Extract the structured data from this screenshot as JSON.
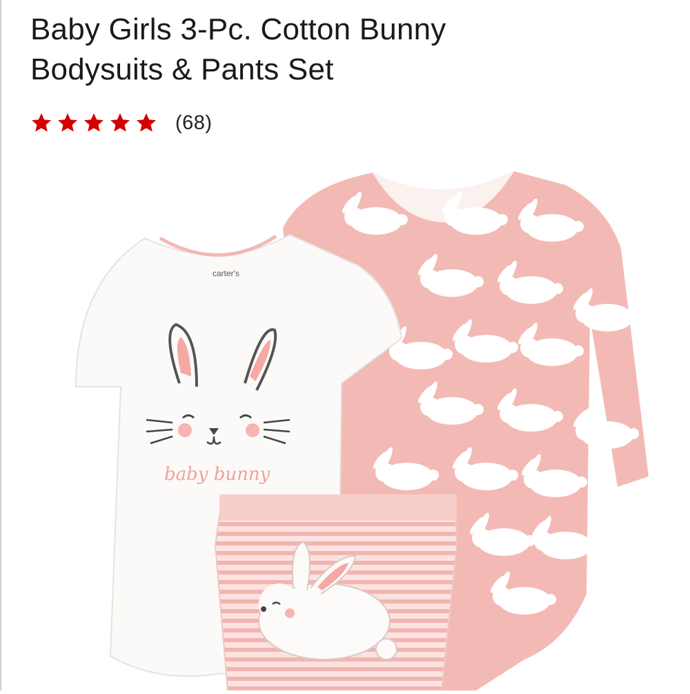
{
  "product": {
    "title_line1": "Baby Girls 3-Pc. Cotton Bunny",
    "title_line2": "Bodysuits & Pants Set",
    "rating": {
      "stars": 5,
      "max": 5,
      "count": "(68)"
    },
    "image": {
      "bodysuit_text": "baby bunny",
      "brand_tag": "carter's"
    }
  },
  "colors": {
    "star": "#d40000",
    "pink": "#f2b9b5",
    "white_garment": "#fbfaf8"
  }
}
